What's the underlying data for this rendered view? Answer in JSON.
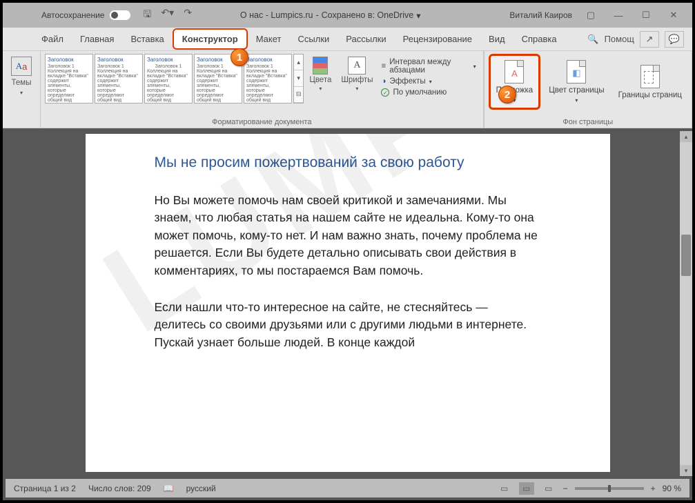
{
  "titlebar": {
    "autosave": "Автосохранение",
    "doc_name": "О нас - Lumpics.ru",
    "saved_to": "Сохранено в: OneDrive",
    "user": "Виталий Каиров"
  },
  "tabs": {
    "file": "Файл",
    "home": "Главная",
    "insert": "Вставка",
    "design": "Конструктор",
    "layout": "Макет",
    "references": "Ссылки",
    "mailings": "Рассылки",
    "review": "Рецензирование",
    "view": "Вид",
    "help": "Справка",
    "assist": "Помощ"
  },
  "ribbon": {
    "themes": "Темы",
    "style_hdr": "Заголовок",
    "style_sub": "Заголовок 1",
    "colors": "Цвета",
    "fonts": "Шрифты",
    "spacing": "Интервал между абзацами",
    "effects": "Эффекты",
    "default": "По умолчанию",
    "group_format": "Форматирование документа",
    "watermark": "Подложка",
    "page_color": "Цвет страницы",
    "page_borders": "Границы страниц",
    "group_bg": "Фон страницы"
  },
  "badges": {
    "one": "1",
    "two": "2"
  },
  "document": {
    "watermark": "LUMPI",
    "heading": "Мы не просим пожертвований за свою работу",
    "p1": "Но Вы можете помочь нам своей критикой и замечаниями. Мы знаем, что любая статья на нашем сайте не идеальна. Кому-то она может помочь, кому-то нет. И нам важно знать, почему проблема не решается. Если Вы будете детально описывать свои действия в комментариях, то мы постараемся Вам помочь.",
    "p2": "Если нашли что-то интересное на сайте, не стесняйтесь — делитесь со своими друзьями или с другими людьми в интернете. Пускай узнает больше людей. В конце каждой"
  },
  "statusbar": {
    "page": "Страница 1 из 2",
    "words": "Число слов: 209",
    "lang": "русский",
    "zoom": "90 %"
  }
}
